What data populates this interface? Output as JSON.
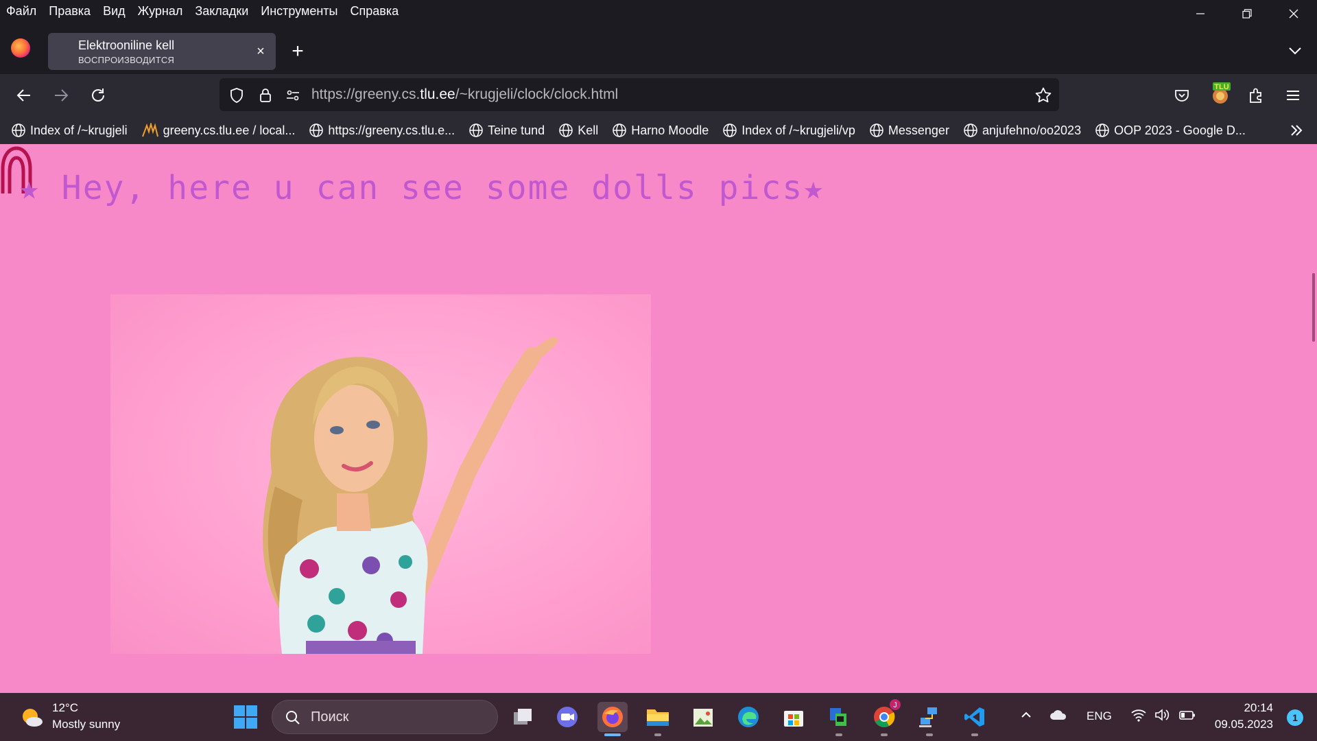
{
  "menu": [
    "Файл",
    "Правка",
    "Вид",
    "Журнал",
    "Закладки",
    "Инструменты",
    "Справка"
  ],
  "tab": {
    "title": "Elektrooniline kell",
    "subtitle": "ВОСПРОИЗВОДИТСЯ"
  },
  "url": {
    "prefix": "https://greeny.cs.",
    "domain": "tlu.ee",
    "path": "/~krugjeli/clock/clock.html"
  },
  "extension": {
    "label": "TLU"
  },
  "bookmarks": [
    "Index of /~krugjeli",
    "greeny.cs.tlu.ee / local...",
    "https://greeny.cs.tlu.e...",
    "Teine tund",
    "Kell",
    "Harno Moodle",
    "Index of /~krugjeli/vp",
    "Messenger",
    "anjufehno/oo2023",
    "OOP 2023 - Google D..."
  ],
  "page": {
    "heading": "★ Hey, here u can see some dolls pics★"
  },
  "taskbar": {
    "weather_temp": "12°C",
    "weather_desc": "Mostly sunny",
    "search_placeholder": "Поиск",
    "chrome_badge": "J",
    "language": "ENG",
    "time": "20:14",
    "date": "09.05.2023",
    "notifications": "1"
  },
  "colors": {
    "page_bg": "#f889c8",
    "heading": "#c258cf",
    "taskbar": "#3a2533"
  }
}
